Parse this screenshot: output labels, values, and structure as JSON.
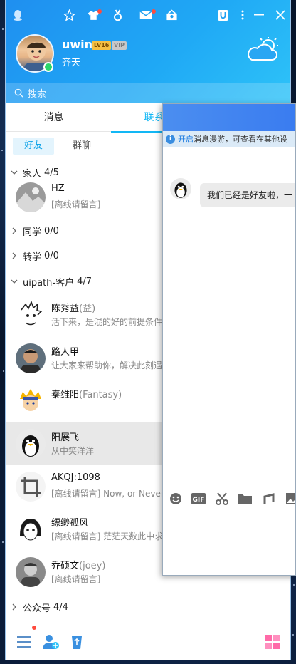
{
  "window": {
    "user_name": "uwin",
    "level_badge": "LV16",
    "vip_badge": "VIP",
    "signature": "齐天",
    "toolbar_icons": [
      "qq-logo-icon",
      "star-icon",
      "shirt-icon",
      "medal-icon",
      "mail-icon",
      "gift-box-icon",
      "u-app-icon",
      "more-icon",
      "minimize-icon",
      "close-icon"
    ]
  },
  "search": {
    "placeholder": "搜索"
  },
  "tabs": [
    {
      "label": "消息"
    },
    {
      "label": "联系人"
    }
  ],
  "subtabs": [
    {
      "label": "好友"
    },
    {
      "label": "群聊"
    }
  ],
  "groups": {
    "family": {
      "label": "家人",
      "count": "4/5"
    },
    "classmates": {
      "label": "同学",
      "count": "0/0"
    },
    "transfer": {
      "label": "转学",
      "count": "0/0"
    },
    "uipath": {
      "label": "uipath-客户",
      "count": "4/7"
    },
    "official": {
      "label": "公众号",
      "count": "4/4"
    }
  },
  "contacts": [
    {
      "name": "HZ",
      "remark": "",
      "msg": "[离线请留言]"
    },
    {
      "name": "陈秀益",
      "remark": "(益)",
      "msg": "活下来，是混的好的前提条件"
    },
    {
      "name": "路人甲",
      "remark": "",
      "msg": "让大家来帮助你，解决此刻遇"
    },
    {
      "name": "秦维阳",
      "remark": "(Fantasy)",
      "msg": ""
    },
    {
      "name": "阳展飞",
      "remark": "",
      "msg": "从中笑洋洋"
    },
    {
      "name": "AKQJ:1098",
      "remark": "",
      "msg": "[离线请留言]  Now, or Never"
    },
    {
      "name": "缥缈孤风",
      "remark": "",
      "msg": "[离线请留言]  茫茫天数此中求"
    },
    {
      "name": "乔硕文",
      "remark": "(joey)",
      "msg": "[离线请留言]"
    }
  ],
  "chat": {
    "notice_link": "开启",
    "notice_text": "消息漫游，可查看在其他设",
    "message": "我们已经是好友啦，一"
  },
  "colors": {
    "accent": "#12b7f5",
    "header": "#1f8ff0",
    "online": "#2bd66b",
    "notify": "#ff4b3e"
  }
}
